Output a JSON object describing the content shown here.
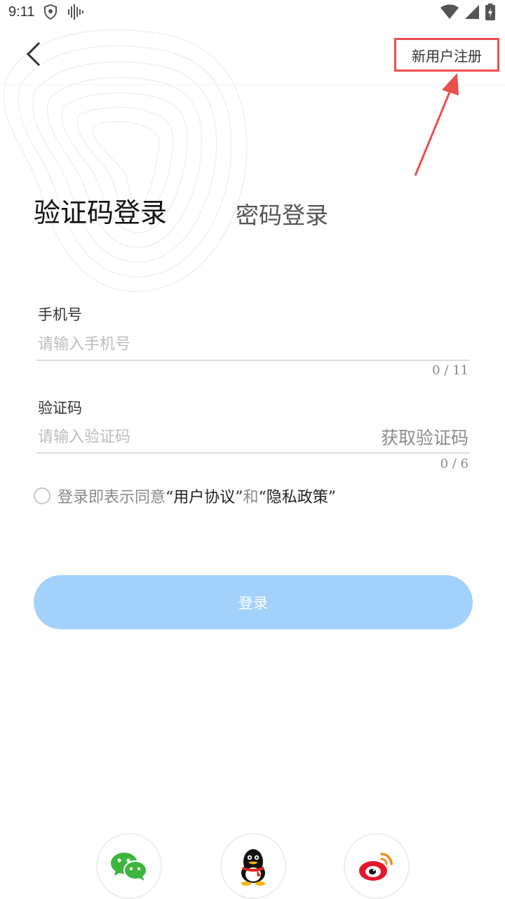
{
  "status_bar": {
    "time": "9:11"
  },
  "header": {
    "register_label": "新用户注册"
  },
  "tabs": {
    "code_login": "验证码登录",
    "password_login": "密码登录"
  },
  "phone": {
    "label": "手机号",
    "placeholder": "请输入手机号",
    "counter": "0 / 11"
  },
  "code": {
    "label": "验证码",
    "placeholder": "请输入验证码",
    "counter": "0 / 6",
    "get_code_label": "获取验证码"
  },
  "agreement": {
    "prefix": "登录即表示同意",
    "user_agreement": "“用户协议”",
    "and": "和",
    "privacy_policy": "“隐私政策”"
  },
  "login": {
    "label": "登录"
  },
  "colors": {
    "primary_button": "#a2d1fb",
    "highlight": "#ea4f4f"
  },
  "social": [
    "wechat-icon",
    "qq-icon",
    "weibo-icon"
  ]
}
